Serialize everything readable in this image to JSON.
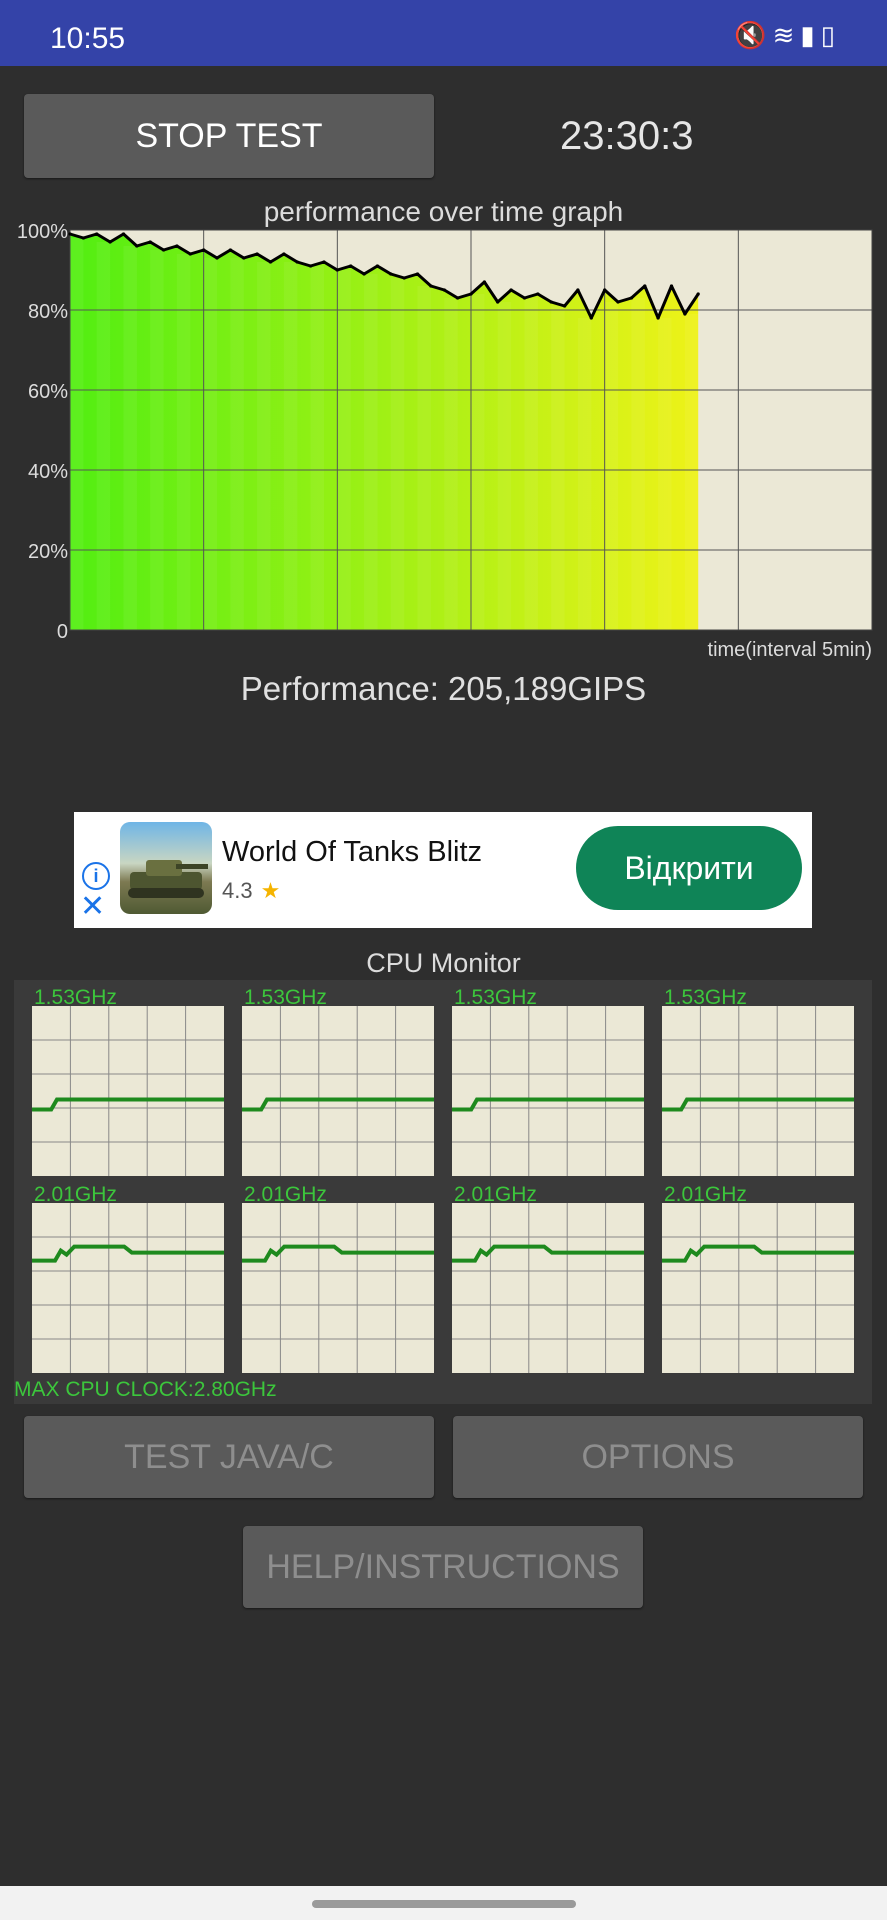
{
  "status_bar": {
    "time": "10:55",
    "icons": [
      "mute-icon",
      "wifi-icon",
      "signal-icon",
      "battery-icon"
    ]
  },
  "header": {
    "stop_label": "STOP TEST",
    "timer": "23:30:3"
  },
  "performance": {
    "title": "performance over time graph",
    "readout": "Performance: 205,189GIPS",
    "x_label": "time(interval 5min)",
    "y_ticks": [
      "100%",
      "80%",
      "60%",
      "40%",
      "20%",
      "0"
    ]
  },
  "chart_data": {
    "type": "area",
    "title": "performance over time graph",
    "xlabel": "time(interval 5min)",
    "ylabel": "",
    "ylim": [
      0,
      100
    ],
    "xlim": [
      0,
      30
    ],
    "x": [
      0,
      0.5,
      1,
      1.5,
      2,
      2.5,
      3,
      3.5,
      4,
      4.5,
      5,
      5.5,
      6,
      6.5,
      7,
      7.5,
      8,
      8.5,
      9,
      9.5,
      10,
      10.5,
      11,
      11.5,
      12,
      12.5,
      13,
      13.5,
      14,
      14.5,
      15,
      15.5,
      16,
      16.5,
      17,
      17.5,
      18,
      18.5,
      19,
      19.5,
      20,
      20.5,
      21,
      21.5,
      22,
      22.5,
      23,
      23.5
    ],
    "values": [
      99,
      98,
      99,
      97,
      99,
      96,
      97,
      95,
      96,
      94,
      95,
      93,
      95,
      93,
      94,
      92,
      94,
      92,
      91,
      92,
      90,
      91,
      89,
      91,
      89,
      88,
      89,
      86,
      85,
      83,
      84,
      87,
      82,
      85,
      83,
      84,
      82,
      81,
      85,
      78,
      85,
      82,
      83,
      86,
      78,
      86,
      79,
      84
    ],
    "grid": true,
    "area_colors": {
      "start": "#52ee12",
      "end": "#eef218"
    },
    "line_color": "#000000",
    "background": "#ebe8d6"
  },
  "ad": {
    "title": "World Of Tanks Blitz",
    "rating": "4.3",
    "cta": "Відкрити",
    "cta_color": "#0f8457"
  },
  "cpu_monitor": {
    "title": "CPU Monitor",
    "line_color": "#1e8a1e",
    "label_color": "#3cc63c",
    "cores": [
      {
        "clock": "1.53GHz",
        "level": 0.45
      },
      {
        "clock": "1.53GHz",
        "level": 0.45
      },
      {
        "clock": "1.53GHz",
        "level": 0.45
      },
      {
        "clock": "1.53GHz",
        "level": 0.45
      },
      {
        "clock": "2.01GHz",
        "level": 0.72
      },
      {
        "clock": "2.01GHz",
        "level": 0.72
      },
      {
        "clock": "2.01GHz",
        "level": 0.72
      },
      {
        "clock": "2.01GHz",
        "level": 0.72
      }
    ],
    "max_clock": "MAX CPU CLOCK:2.80GHz"
  },
  "buttons": {
    "test_label": "TEST JAVA/C",
    "options_label": "OPTIONS",
    "help_label": "HELP/INSTRUCTIONS"
  }
}
